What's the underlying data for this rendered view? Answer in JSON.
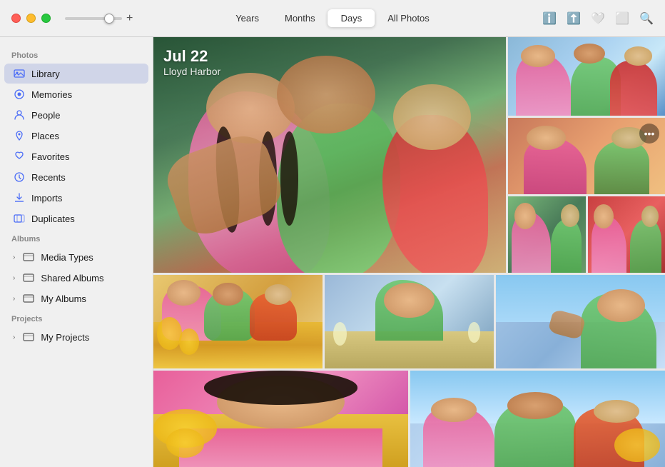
{
  "titlebar": {
    "slider_plus": "+",
    "tabs": [
      {
        "label": "Years",
        "id": "years",
        "active": false
      },
      {
        "label": "Months",
        "id": "months",
        "active": false
      },
      {
        "label": "Days",
        "id": "days",
        "active": true
      },
      {
        "label": "All Photos",
        "id": "allphotos",
        "active": false
      }
    ],
    "icons": [
      "ℹ",
      "⬆",
      "♡",
      "⧉",
      "⌕"
    ]
  },
  "sidebar": {
    "photos_section_label": "Photos",
    "photos_items": [
      {
        "label": "Library",
        "icon": "📷",
        "active": true
      },
      {
        "label": "Memories",
        "icon": "⊕"
      },
      {
        "label": "People",
        "icon": "⊕"
      },
      {
        "label": "Places",
        "icon": "⬆"
      },
      {
        "label": "Favorites",
        "icon": "♡"
      },
      {
        "label": "Recents",
        "icon": "⊙"
      },
      {
        "label": "Imports",
        "icon": "⬆"
      },
      {
        "label": "Duplicates",
        "icon": "⧉"
      }
    ],
    "albums_section_label": "Albums",
    "albums_items": [
      {
        "label": "Media Types"
      },
      {
        "label": "Shared Albums"
      },
      {
        "label": "My Albums"
      }
    ],
    "projects_section_label": "Projects",
    "projects_items": [
      {
        "label": "My Projects"
      }
    ]
  },
  "photo_area": {
    "date": "Jul 22",
    "location": "Lloyd Harbor",
    "more_button": "•••"
  }
}
